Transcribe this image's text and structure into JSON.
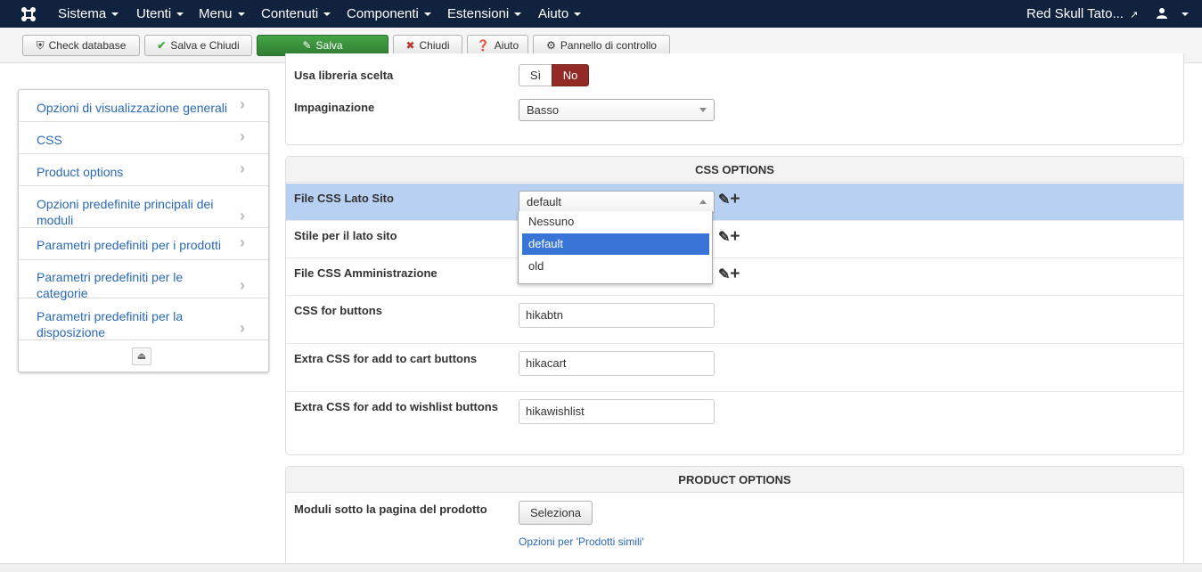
{
  "navbar": {
    "menus": [
      "Sistema",
      "Utenti",
      "Menu",
      "Contenuti",
      "Componenti",
      "Estensioni",
      "Aiuto"
    ],
    "site_name": "Red Skull Tato..."
  },
  "toolbar": {
    "check_database": "Check database",
    "save_close": "Salva e Chiudi",
    "save": "Salva",
    "close": "Chiudi",
    "help": "Aiuto",
    "control_panel": "Pannello di controllo"
  },
  "sidebar": {
    "items": [
      {
        "label": "Opzioni di visualizzazione generali"
      },
      {
        "label": "CSS"
      },
      {
        "label": "Product options"
      },
      {
        "label": "Opzioni predefinite principali dei moduli"
      },
      {
        "label": "Parametri predefiniti per i prodotti"
      },
      {
        "label": "Parametri predefiniti per le categorie"
      },
      {
        "label": "Parametri predefiniti per la disposizione"
      }
    ]
  },
  "top_panel": {
    "library_label": "Usa libreria scelta",
    "toggle_yes": "Sì",
    "toggle_no": "No",
    "toggle_value": "No",
    "pagination_label": "Impaginazione",
    "pagination_value": "Basso"
  },
  "css_panel": {
    "title": "CSS OPTIONS",
    "frontend_css_label": "File CSS Lato Sito",
    "frontend_css_value": "default",
    "dropdown_options": [
      "Nessuno",
      "default",
      "old"
    ],
    "dropdown_selected": "default",
    "frontend_style_label": "Stile per il lato sito",
    "backend_css_label": "File CSS Amministrazione",
    "buttons_label": "CSS for buttons",
    "buttons_value": "hikabtn",
    "cart_label": "Extra CSS for add to cart buttons",
    "cart_value": "hikacart",
    "wishlist_label": "Extra CSS for add to wishlist buttons",
    "wishlist_value": "hikawishlist"
  },
  "product_panel": {
    "title": "PRODUCT OPTIONS",
    "modules_label": "Moduli sotto la pagina del prodotto",
    "select_button": "Seleziona",
    "similar_link": "Opzioni per 'Prodotti simili'"
  },
  "colors": {
    "navbar_bg": "#10223e",
    "save_green": "#46a546",
    "toggle_no_red": "#942a25",
    "row_highlight": "#b8d0f1",
    "link_blue": "#2a69b8",
    "dropdown_selected": "#3875d7"
  }
}
